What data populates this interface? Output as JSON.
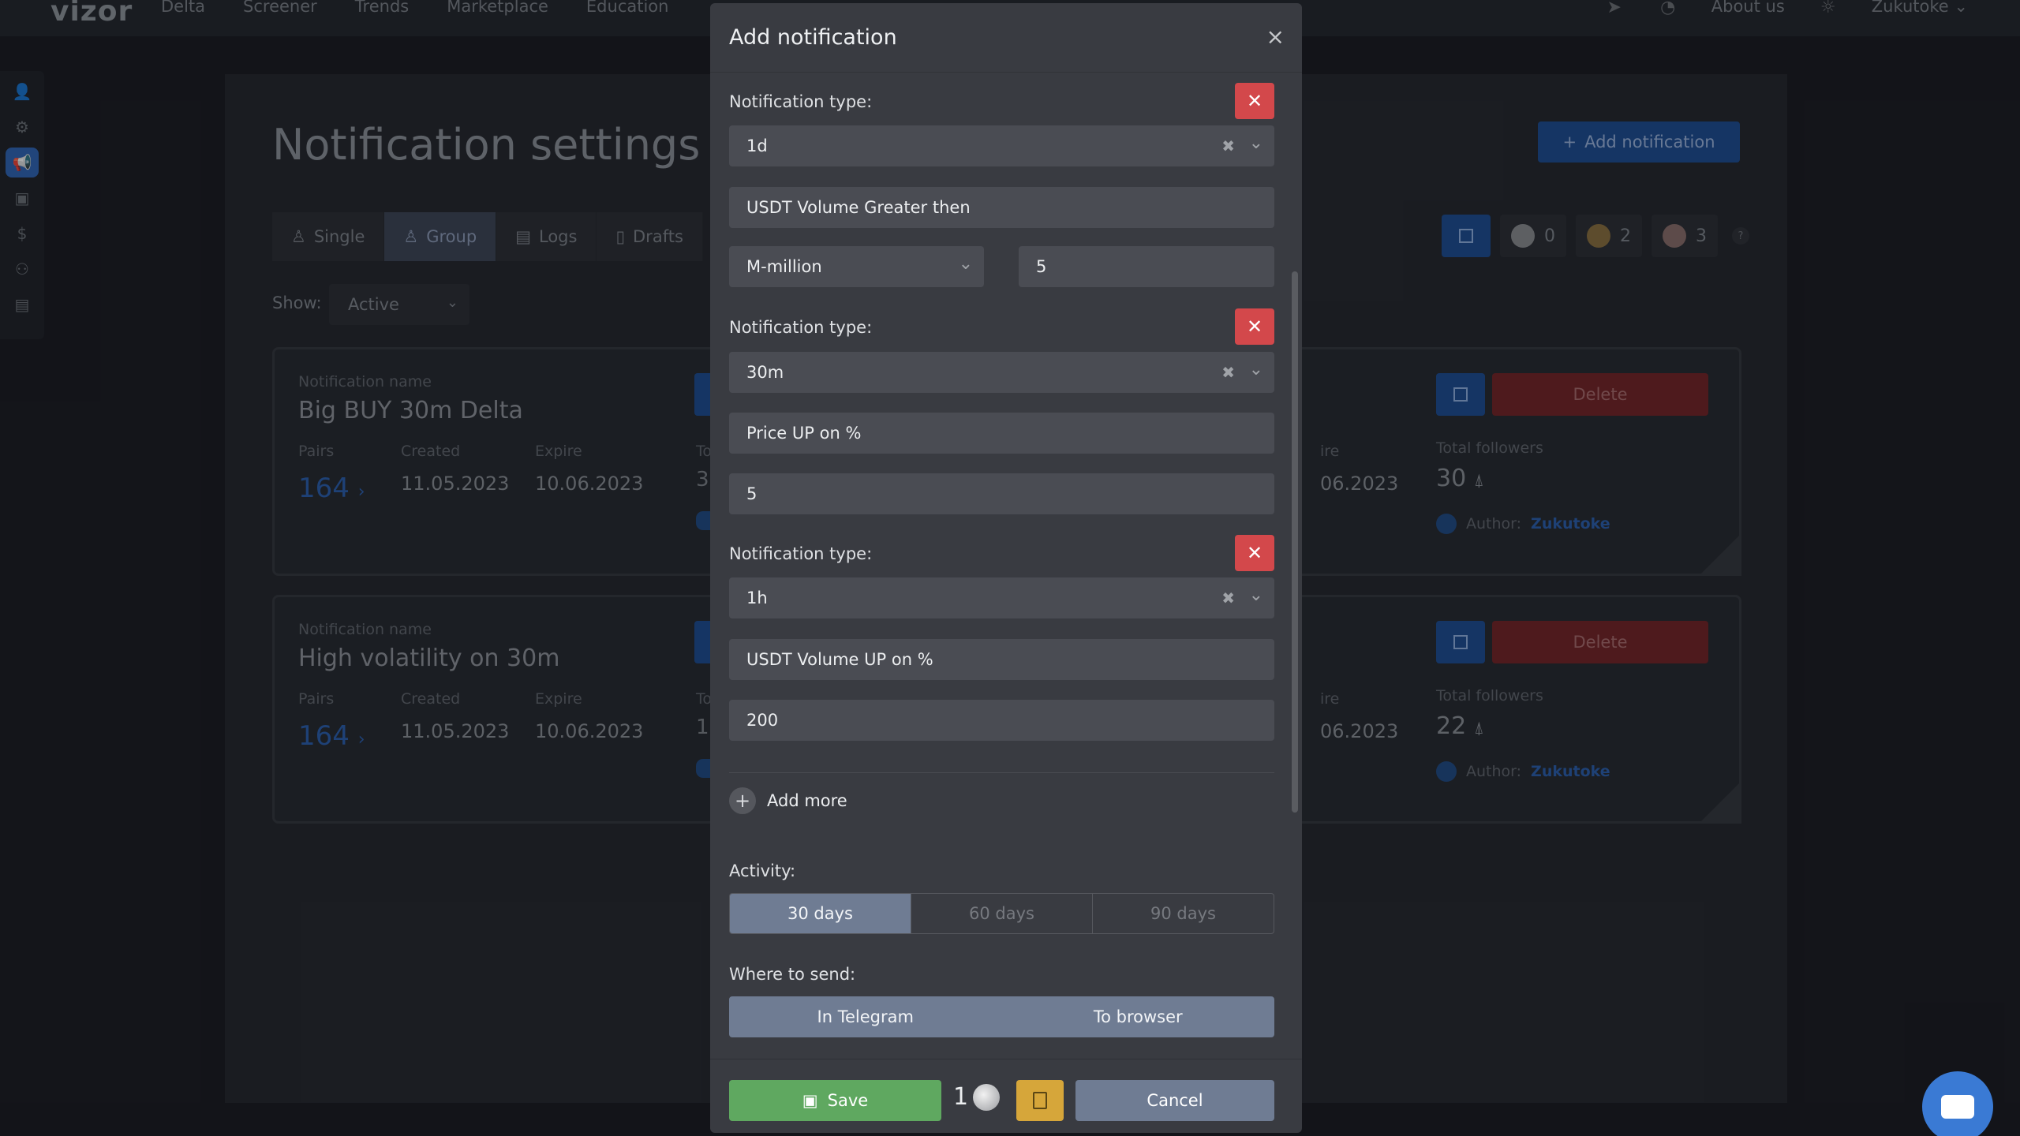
{
  "brand": "vizor",
  "nav": [
    "Delta",
    "Screener",
    "Trends",
    "Marketplace",
    "Education"
  ],
  "topright": {
    "about": "About us",
    "user": "Zukutoke"
  },
  "page": {
    "title": "Notification settings",
    "add_button": "Add notification",
    "tabs": [
      "Single",
      "Group",
      "Logs",
      "Drafts"
    ],
    "show_label": "Show:",
    "show_value": "Active",
    "counters": [
      "0",
      "2",
      "3"
    ],
    "help": "?"
  },
  "cards": [
    {
      "name_label": "Notification name",
      "name": "Big BUY 30m Delta",
      "pairs_label": "Pairs",
      "pairs": "164",
      "created_label": "Created",
      "created": "11.05.2023",
      "expire_label": "Expire",
      "expire": "10.06.2023",
      "edge_label": "To",
      "edge_value": "3",
      "right_expire_label": "ire",
      "right_expire": "06.2023",
      "delete": "Delete",
      "followers_label": "Total followers",
      "followers": "30",
      "author_label": "Author:",
      "author": "Zukutoke"
    },
    {
      "name_label": "Notification name",
      "name": "High volatility on 30m",
      "pairs_label": "Pairs",
      "pairs": "164",
      "created_label": "Created",
      "created": "11.05.2023",
      "expire_label": "Expire",
      "expire": "10.06.2023",
      "edge_label": "To",
      "edge_value": "1",
      "right_expire_label": "ire",
      "right_expire": "06.2023",
      "delete": "Delete",
      "followers_label": "Total followers",
      "followers": "22",
      "author_label": "Author:",
      "author": "Zukutoke"
    }
  ],
  "modal": {
    "title": "Add notification",
    "close": "×",
    "type_label": "Notification type:",
    "conditions": [
      {
        "interval": "1d",
        "metric": "USDT Volume Greater then",
        "unit": "M-million",
        "value": "5"
      },
      {
        "interval": "30m",
        "metric": "Price UP on %",
        "value": "5"
      },
      {
        "interval": "1h",
        "metric": "USDT Volume UP on %",
        "value": "200"
      }
    ],
    "add_more": "Add more",
    "activity_label": "Activity:",
    "activity_options": [
      "30 days",
      "60 days",
      "90 days"
    ],
    "send_label": "Where to send:",
    "send_options": [
      "In Telegram",
      "To browser"
    ],
    "save": "Save",
    "coin_count": "1",
    "cancel": "Cancel"
  },
  "colors": {
    "primary": "#1d4c93",
    "danger": "#d3484b",
    "success": "#5fa860",
    "warning": "#d6a63a",
    "segment": "#6f7c93"
  }
}
